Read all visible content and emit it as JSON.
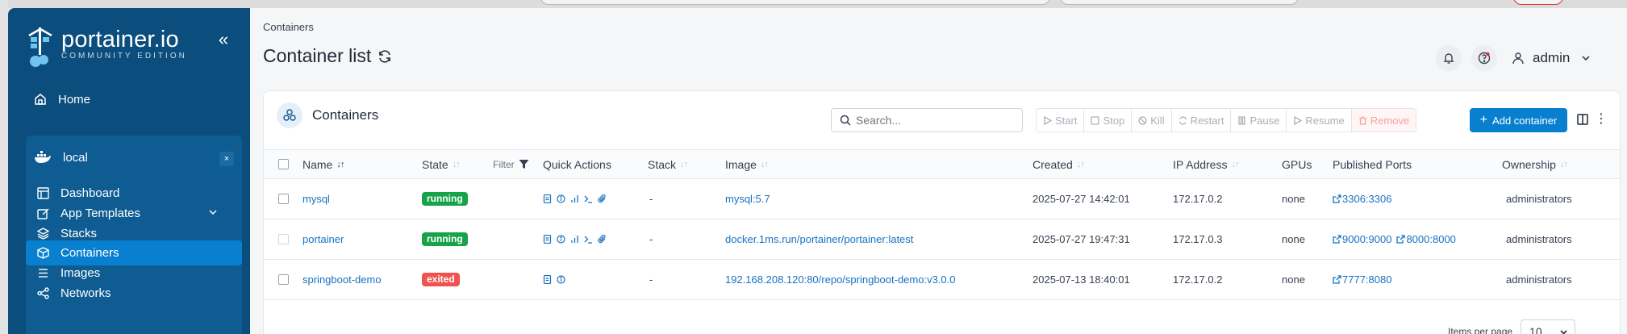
{
  "sidebar": {
    "brand_name": "portainer.io",
    "brand_edition": "COMMUNITY EDITION",
    "home_label": "Home",
    "environment": {
      "name": "local",
      "close_label": "×"
    },
    "items": [
      {
        "label": "Dashboard",
        "icon": "dashboard-icon"
      },
      {
        "label": "App Templates",
        "icon": "edit-icon",
        "expandable": true
      },
      {
        "label": "Stacks",
        "icon": "layers-icon"
      },
      {
        "label": "Containers",
        "icon": "box-icon",
        "active": true
      },
      {
        "label": "Images",
        "icon": "list-icon"
      },
      {
        "label": "Networks",
        "icon": "share-icon"
      }
    ]
  },
  "header": {
    "breadcrumb": "Containers",
    "title": "Container list",
    "username": "admin"
  },
  "card": {
    "title": "Containers",
    "search_placeholder": "Search...",
    "actions": {
      "start": "Start",
      "stop": "Stop",
      "kill": "Kill",
      "restart": "Restart",
      "pause": "Pause",
      "resume": "Resume",
      "remove": "Remove"
    },
    "add_label": "Add container"
  },
  "table": {
    "columns": {
      "name": "Name",
      "state": "State",
      "filter": "Filter",
      "quick_actions": "Quick Actions",
      "stack": "Stack",
      "image": "Image",
      "created": "Created",
      "ip": "IP Address",
      "gpus": "GPUs",
      "ports": "Published Ports",
      "ownership": "Ownership"
    },
    "rows": [
      {
        "name": "mysql",
        "state": "running",
        "stack": "-",
        "image": "mysql:5.7",
        "created": "2025-07-27 14:42:01",
        "ip": "172.17.0.2",
        "gpus": "none",
        "port1": "3306:3306",
        "port2": "",
        "ownership": "administrators"
      },
      {
        "name": "portainer",
        "state": "running",
        "stack": "-",
        "image": "docker.1ms.run/portainer/portainer:latest",
        "created": "2025-07-27 19:47:31",
        "ip": "172.17.0.3",
        "gpus": "none",
        "port1": "9000:9000",
        "port2": "8000:8000",
        "ownership": "administrators"
      },
      {
        "name": "springboot-demo",
        "state": "exited",
        "stack": "-",
        "image": "192.168.208.120:80/repo/springboot-demo:v3.0.0",
        "created": "2025-07-13 18:40:01",
        "ip": "172.17.0.2",
        "gpus": "none",
        "port1": "7777:8080",
        "port2": "",
        "ownership": "administrators"
      }
    ]
  },
  "footer": {
    "items_per_page_label": "Items per page",
    "items_per_page_value": "10"
  },
  "colors": {
    "sidebar_bg": "#0b4d7d",
    "env_box_bg": "#0e5c92",
    "accent": "#0880cf",
    "running": "#16a34a",
    "exited": "#ef5350",
    "link": "#1572c2"
  }
}
